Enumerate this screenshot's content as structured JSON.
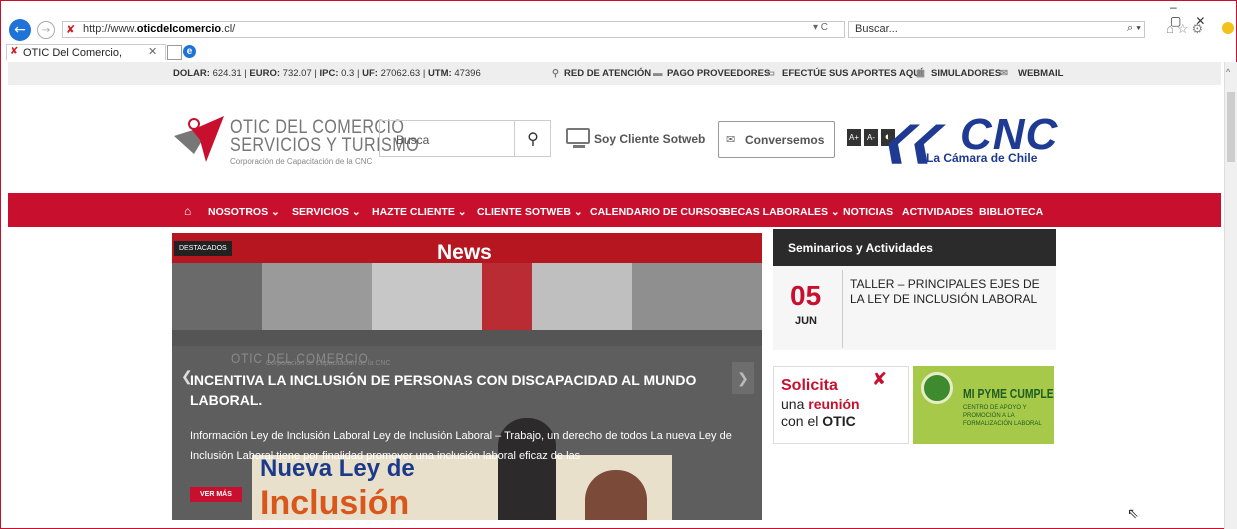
{
  "browser": {
    "url_prefix": "http://www.",
    "url_domain": "oticdelcomercio",
    "url_suffix": ".cl/",
    "url_controls": "▾ C",
    "search_placeholder": "Buscar...",
    "search_icon": "⌕ ▾",
    "tools_icons": "⌂☆⚙",
    "window_controls": "–▢✕",
    "tab_title": "OTIC Del Comercio, Servici...",
    "tab_close": "✕",
    "ie_icon": "e"
  },
  "topbar": {
    "rates": [
      {
        "label": "DOLAR:",
        "value": "624.31"
      },
      {
        "label": "EURO:",
        "value": "732.07"
      },
      {
        "label": "IPC:",
        "value": "0.3"
      },
      {
        "label": "UF:",
        "value": "27062.63"
      },
      {
        "label": "UTM:",
        "value": "47396"
      }
    ],
    "links": [
      "RED DE ATENCIÓN",
      "PAGO PROVEEDORES",
      "EFECTÚE SUS APORTES AQUÍ",
      "SIMULADORES",
      "WEBMAIL"
    ],
    "link_icons": [
      "⚲",
      "▬",
      "▭",
      "▦",
      "✉"
    ]
  },
  "header": {
    "logo_line1": "OTIC DEL COMERCIO",
    "logo_line2": "SERVICIOS Y TURISMO",
    "logo_line3": "Corporación de Capacitación de la CNC",
    "search_placeholder": "Busca",
    "search_icon": "⚲",
    "soy_cliente": "Soy Cliente Sotweb",
    "conversemos_icon": "✉",
    "conversemos": "Conversemos",
    "font_buttons": [
      "A+",
      "A-",
      "◐"
    ],
    "cnc_arrows": "❮❮",
    "cnc_name": "CNC",
    "cnc_sub": "La Cámara de Chile"
  },
  "nav": {
    "home_icon": "⌂",
    "items": [
      "NOSOTROS ⌄",
      "SERVICIOS ⌄",
      "HAZTE CLIENTE ⌄",
      "CLIENTE SOTWEB ⌄",
      "CALENDARIO DE CURSOS",
      "BECAS LABORALES ⌄",
      "NOTICIAS",
      "ACTIVIDADES",
      "BIBLIOTECA"
    ]
  },
  "news": {
    "badge": "DESTACADOS",
    "title": "News",
    "slide_logo": "OTIC DEL COMERCIO",
    "slide_logo_sub": "Corporación de Capacitación de la CNC",
    "slide_title": "INCENTIVA LA INCLUSIÓN DE PERSONAS CON DISCAPACIDAD AL MUNDO LABORAL.",
    "slide_desc": "Información Ley de Inclusión Laboral Ley de Inclusión Laboral – Trabajo, un derecho de todos La nueva Ley de Inclusión Laboral tiene por finalidad promover una inclusión laboral eficaz de las",
    "sign_text1": "Nueva Ley de",
    "sign_text2": "Inclusión",
    "ver_mas": "VER MÁS",
    "arrow_left": "❮",
    "arrow_right": "❯"
  },
  "sidebar": {
    "title": "Seminarios y Actividades",
    "event": {
      "day": "05",
      "month": "JUN",
      "title": "TALLER – PRINCIPALES EJES DE LA LEY DE INCLUSIÓN LABORAL"
    },
    "solicita": {
      "line1": "Solicita",
      "line2_pre": "una ",
      "line2_bold": "reunión",
      "line3_pre": "con el ",
      "line3_bold": "OTIC"
    },
    "pyme": {
      "title": "MI PYME CUMPLE",
      "sub": "CENTRO DE APOYO Y PROMOCIÓN A LA FORMALIZACIÓN LABORAL"
    }
  },
  "colors": {
    "brand_red": "#c8102e",
    "cnc_blue": "#1f3a93",
    "pyme_green": "#a7c94a"
  }
}
